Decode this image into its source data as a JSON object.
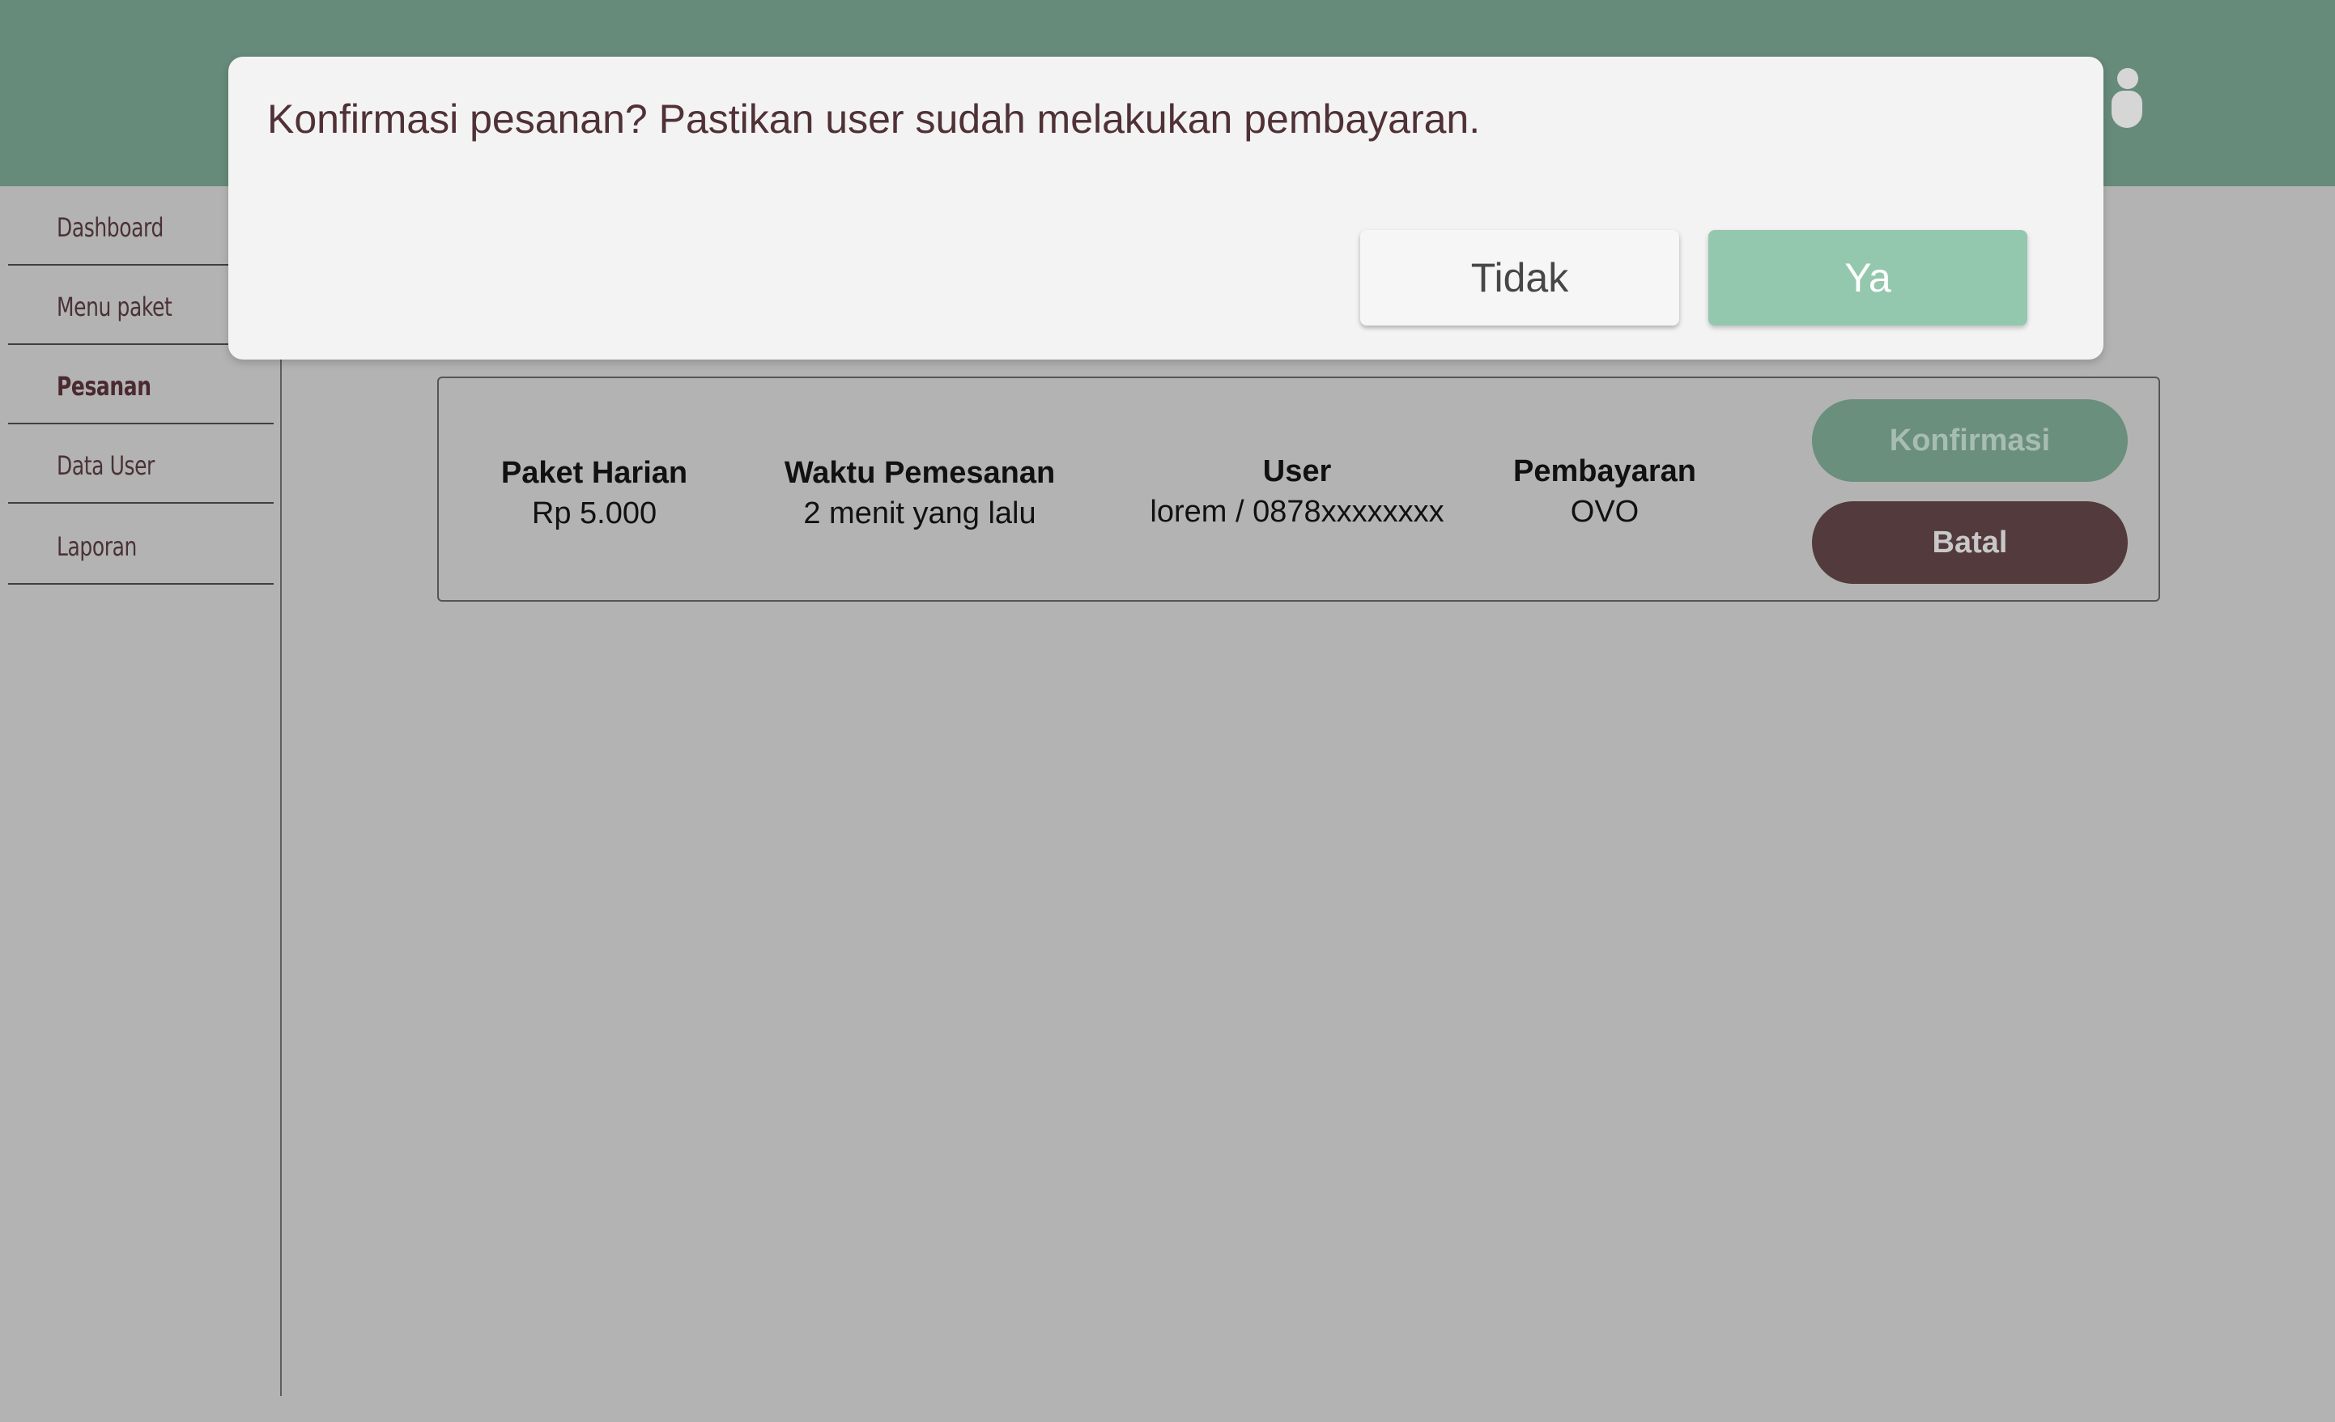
{
  "colors": {
    "header": "#668b7a",
    "background": "#b3b3b3",
    "dialog": "#f3f3f3",
    "accent_green": "#94c8ae",
    "confirm_pill": "#6a8f7d",
    "cancel_pill": "#533a3c",
    "brand_dark": "#4f3136"
  },
  "header": {
    "user_icon": "user-icon"
  },
  "sidebar": {
    "items": [
      {
        "label": "Dashboard",
        "active": false
      },
      {
        "label": "Menu paket",
        "active": false
      },
      {
        "label": "Pesanan",
        "active": true
      },
      {
        "label": "Data User",
        "active": false
      },
      {
        "label": "Laporan",
        "active": false
      }
    ]
  },
  "order": {
    "package": {
      "label": "Paket Harian",
      "value": "Rp 5.000"
    },
    "time": {
      "label": "Waktu Pemesanan",
      "value": "2 menit yang lalu"
    },
    "user": {
      "label": "User",
      "value": "lorem / 0878xxxxxxxx"
    },
    "payment": {
      "label": "Pembayaran",
      "value": "OVO"
    },
    "confirm_label": "Konfirmasi",
    "cancel_label": "Batal"
  },
  "dialog": {
    "message": "Konfirmasi pesanan? Pastikan user sudah melakukan pembayaran.",
    "no_label": "Tidak",
    "yes_label": "Ya"
  }
}
